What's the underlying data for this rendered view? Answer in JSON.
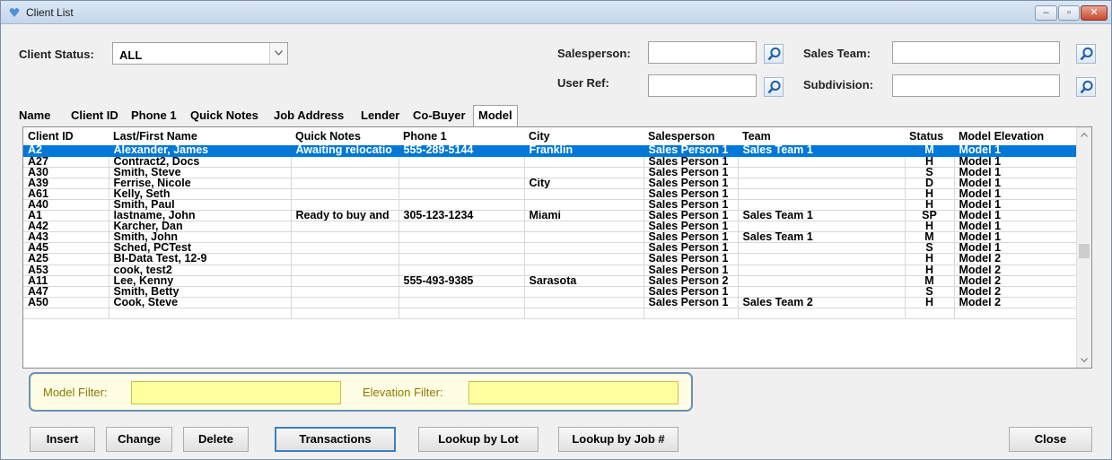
{
  "window": {
    "title": "Client List"
  },
  "filters": {
    "client_status_label": "Client Status:",
    "client_status_value": "ALL",
    "salesperson_label": "Salesperson:",
    "sales_team_label": "Sales Team:",
    "user_ref_label": "User Ref:",
    "subdivision_label": "Subdivision:"
  },
  "tabs": [
    "Name",
    "Client ID",
    "Phone 1",
    "Quick Notes",
    "Job Address",
    "Lender",
    "Co-Buyer",
    "Model"
  ],
  "active_tab": "Model",
  "grid": {
    "columns": [
      "Client ID",
      "Last/First Name",
      "Quick Notes",
      "Phone 1",
      "City",
      "Salesperson",
      "Team",
      "Status",
      "Model Elevation"
    ],
    "rows": [
      [
        "A2",
        "Alexander, James",
        "Awaiting relocatio",
        "555-289-5144",
        "Franklin",
        "Sales Person 1",
        "Sales Team 1",
        "M",
        "Model 1"
      ],
      [
        "A27",
        "Contract2, Docs",
        "",
        "",
        "",
        "Sales Person 1",
        "",
        "H",
        "Model 1"
      ],
      [
        "A30",
        "Smith, Steve",
        "",
        "",
        "",
        "Sales Person 1",
        "",
        "S",
        "Model 1"
      ],
      [
        "A39",
        "Ferrise, Nicole",
        "",
        "",
        "City",
        "Sales Person 1",
        "",
        "D",
        "Model 1"
      ],
      [
        "A61",
        "Kelly, Seth",
        "",
        "",
        "",
        "Sales Person 1",
        "",
        "H",
        "Model 1"
      ],
      [
        "A40",
        "Smith, Paul",
        "",
        "",
        "",
        "Sales Person 1",
        "",
        "H",
        "Model 1"
      ],
      [
        "A1",
        "lastname, John",
        "Ready to buy and",
        "305-123-1234",
        "Miami",
        "Sales Person 1",
        "Sales Team 1",
        "SP",
        "Model 1"
      ],
      [
        "A42",
        "Karcher, Dan",
        "",
        "",
        "",
        "Sales Person 1",
        "",
        "H",
        "Model 1"
      ],
      [
        "A43",
        "Smith, John",
        "",
        "",
        "",
        "Sales Person 1",
        "Sales Team 1",
        "M",
        "Model 1"
      ],
      [
        "A45",
        "Sched, PCTest",
        "",
        "",
        "",
        "Sales Person 1",
        "",
        "S",
        "Model 1"
      ],
      [
        "A25",
        "BI-Data Test, 12-9",
        "",
        "",
        "",
        "Sales Person 1",
        "",
        "H",
        "Model 2"
      ],
      [
        "A53",
        "cook, test2",
        "",
        "",
        "",
        "Sales Person 1",
        "",
        "H",
        "Model 2"
      ],
      [
        "A11",
        "Lee, Kenny",
        "",
        "555-493-9385",
        "Sarasota",
        "Sales Person 2",
        "",
        "M",
        "Model 2"
      ],
      [
        "A47",
        "Smith, Betty",
        "",
        "",
        "",
        "Sales Person 1",
        "",
        "S",
        "Model 2"
      ],
      [
        "A50",
        "Cook, Steve",
        "",
        "",
        "",
        "Sales Person 1",
        "Sales Team 2",
        "H",
        "Model 2"
      ]
    ],
    "selected_row": 0
  },
  "model_filters": {
    "model_label": "Model Filter:",
    "elevation_label": "Elevation Filter:"
  },
  "buttons": {
    "insert": "Insert",
    "change": "Change",
    "delete": "Delete",
    "transactions": "Transactions",
    "lookup_lot": "Lookup by Lot",
    "lookup_job": "Lookup by Job #",
    "close": "Close"
  },
  "colors": {
    "selection": "#0078d7",
    "filter_bg": "#ffffa0",
    "filter_label": "#8a7a00"
  },
  "icons": [
    "app-icon",
    "magnifier-icon",
    "minimize-icon",
    "maximize-icon",
    "close-icon"
  ]
}
